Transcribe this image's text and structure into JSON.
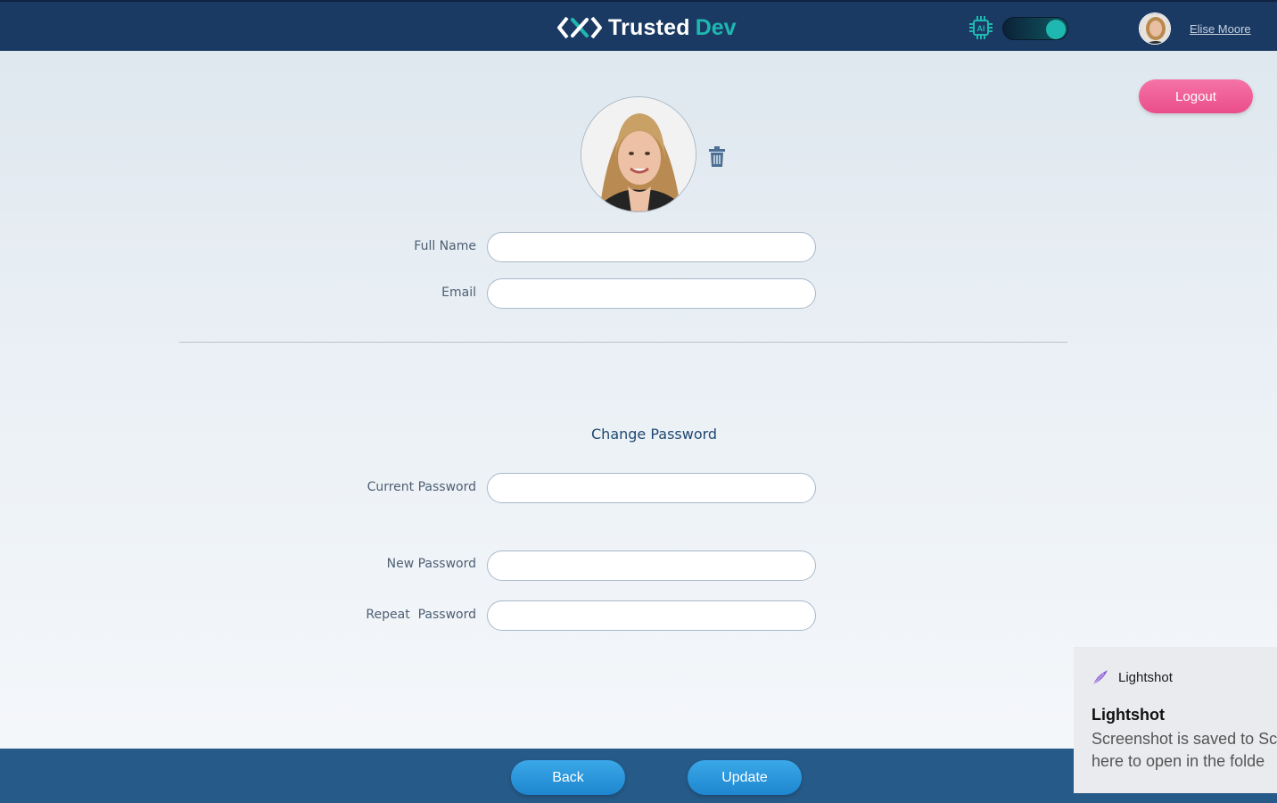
{
  "header": {
    "logo_word1": "Trusted",
    "logo_word2": "Dev",
    "ai_toggle_on": true,
    "user_name": "Elise Moore"
  },
  "actions": {
    "logout_label": "Logout"
  },
  "profile_form": {
    "full_name_label": "Full Name",
    "full_name_value": "",
    "email_label": "Email",
    "email_value": ""
  },
  "password_form": {
    "title": "Change Password",
    "current_label": "Current Password",
    "new_label": "New Password",
    "repeat_label": "Repeat  Password"
  },
  "footer": {
    "back_label": "Back",
    "update_label": "Update"
  },
  "notification": {
    "app_name": "Lightshot",
    "title": "Lightshot",
    "body_line1": "Screenshot is saved to Sc",
    "body_line2": "here to open in the folde"
  },
  "colors": {
    "header_bg": "#1a3a63",
    "accent_teal": "#1fb8b0",
    "logout_pink": "#ea4e8a",
    "button_blue": "#1e86cf",
    "footer_bg": "#265a88"
  },
  "icons": {
    "ai": "ai-chip-icon",
    "trash": "trash-icon",
    "notification_app": "feather-icon"
  }
}
